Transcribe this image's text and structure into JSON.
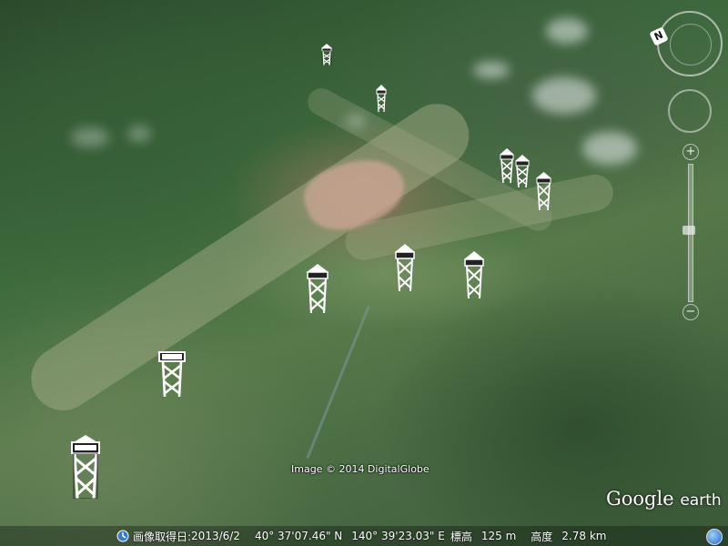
{
  "imagery_credit": "Image © 2014 DigitalGlobe",
  "brand": {
    "name": "Google",
    "product": "earth"
  },
  "status_bar": {
    "imagery_date_label": "画像取得日:",
    "imagery_date": "2013/6/2",
    "latitude": "40° 37'07.46\" N",
    "longitude": "140° 39'23.03\" E",
    "elevation_label": "標高",
    "elevation": "125 m",
    "altitude_label": "高度",
    "altitude": "2.78 km"
  },
  "navigation": {
    "north_label": "N",
    "zoom_in_label": "+",
    "zoom_out_label": "−"
  },
  "placemarks": {
    "icon": "lookout-tower-icon",
    "count": 10
  },
  "colors": {
    "text": "#ffffff",
    "placemark": "#ffffff"
  }
}
